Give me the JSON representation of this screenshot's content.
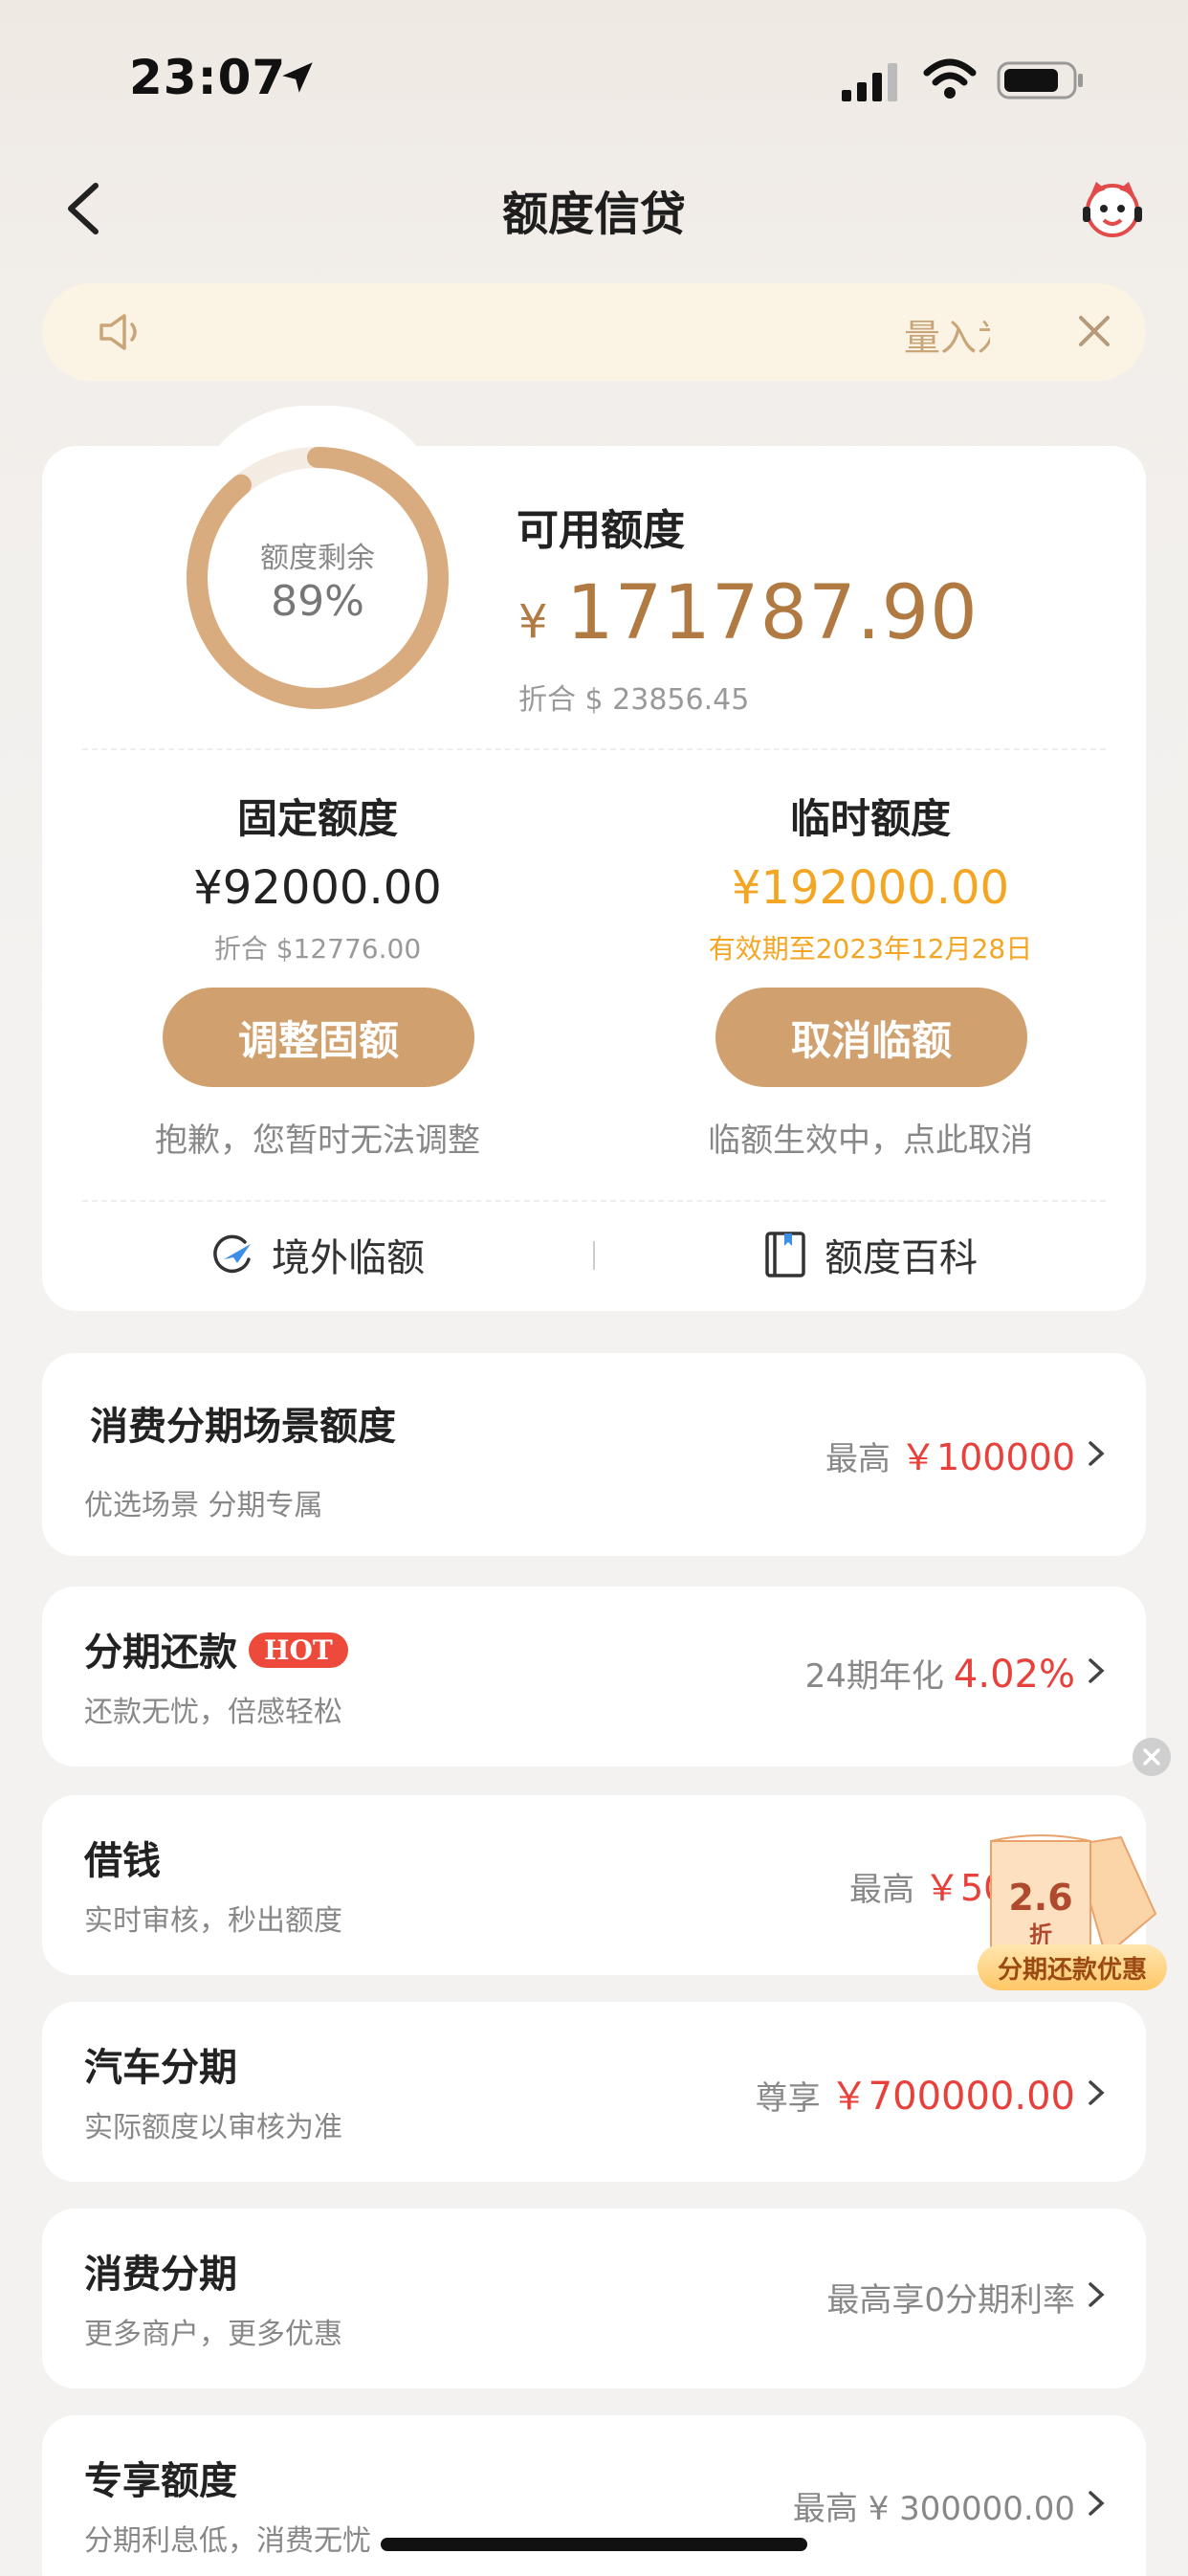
{
  "status_bar": {
    "time": "23:07"
  },
  "nav": {
    "title": "额度信贷"
  },
  "notice": {
    "text": "量入为出"
  },
  "quota": {
    "ring_label": "额度剩余",
    "ring_percent_text": "89%",
    "ring_percent": 0.89,
    "available_title": "可用额度",
    "currency": "¥",
    "available_amount": "171787.90",
    "available_converted": "折合 $ 23856.45",
    "fixed": {
      "title": "固定额度",
      "amount": "¥92000.00",
      "converted": "折合 $12776.00",
      "button": "调整固额",
      "note": "抱歉，您暂时无法调整"
    },
    "temp": {
      "title": "临时额度",
      "amount": "¥192000.00",
      "validity": "有效期至2023年12月28日",
      "button": "取消临额",
      "note": "临额生效中，点此取消"
    },
    "links": {
      "overseas": "境外临额",
      "wiki": "额度百科"
    }
  },
  "cards": [
    {
      "title": "消费分期场景额度",
      "subtitle": "优选场景 分期专属",
      "right_prefix": "最高",
      "right_value": "￥100000"
    },
    {
      "title": "分期还款",
      "badge": "HOT",
      "subtitle": "还款无忧，倍感轻松",
      "right_prefix": "24期年化",
      "right_value": "4.02%"
    },
    {
      "title": "借钱",
      "subtitle": "实时审核，秒出额度",
      "right_prefix": "最高",
      "right_value": "￥50"
    },
    {
      "title": "汽车分期",
      "subtitle": "实际额度以审核为准",
      "right_prefix": "尊享",
      "right_value": "￥700000.00"
    },
    {
      "title": "消费分期",
      "subtitle": "更多商户，更多优惠",
      "right_prefix": "最高享0分期利率",
      "right_value": ""
    },
    {
      "title": "专享额度",
      "subtitle": "分期利息低，消费无忧",
      "right_prefix": "最高 ¥ 300000.00",
      "right_value": ""
    }
  ],
  "promo": {
    "discount": "2.6",
    "unit": "折",
    "label": "分期还款优惠"
  },
  "colors": {
    "accent": "#d0a16e",
    "gold_text": "#b07a42",
    "orange": "#f2a623",
    "red": "#e8413c"
  }
}
